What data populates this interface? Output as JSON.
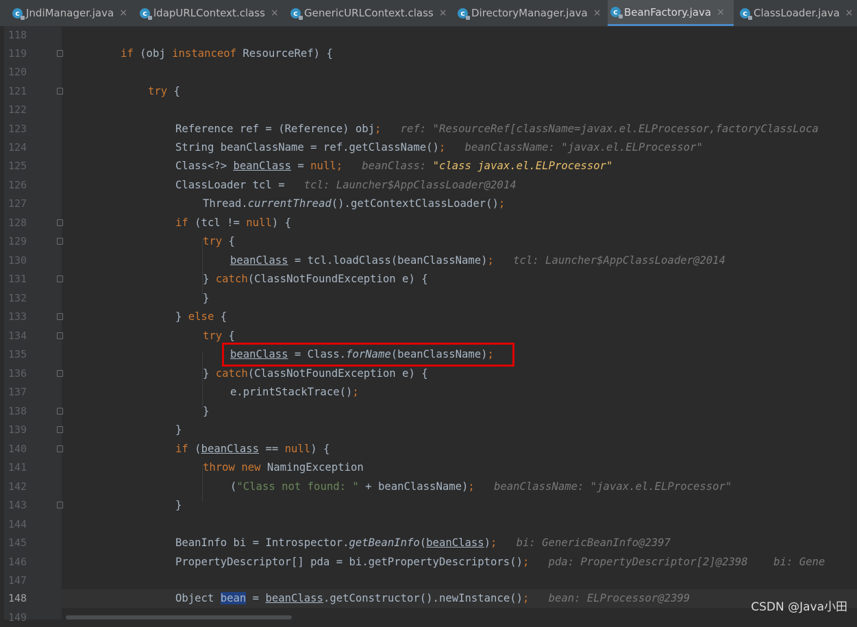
{
  "tabs": [
    {
      "label": "JndiManager.java",
      "close": "×"
    },
    {
      "label": "ldapURLContext.class",
      "close": "×"
    },
    {
      "label": "GenericURLContext.class",
      "close": "×"
    },
    {
      "label": "DirectoryManager.java",
      "close": "×"
    },
    {
      "label": "BeanFactory.java",
      "close": "×"
    },
    {
      "label": "ClassLoader.java",
      "close": "×"
    }
  ],
  "tab_icon_letter": "c",
  "line_numbers": [
    "118",
    "119",
    "120",
    "121",
    "122",
    "123",
    "124",
    "125",
    "126",
    "127",
    "128",
    "129",
    "130",
    "131",
    "132",
    "133",
    "134",
    "135",
    "136",
    "137",
    "138",
    "139",
    "140",
    "141",
    "142",
    "143",
    "144",
    "145",
    "146",
    "147",
    "148",
    "149"
  ],
  "code": {
    "l119": {
      "kw": "if",
      "a": " (obj ",
      "kw2": "instanceof",
      "b": " ResourceRef) {"
    },
    "l121": {
      "kw": "try",
      "a": " {"
    },
    "l123": {
      "a": "Reference ref = (Reference) obj",
      "semi": ";",
      "hint": "ref: \"ResourceRef[className=javax.el.ELProcessor,factoryClassLoca"
    },
    "l124": {
      "a": "String beanClassName = ref.getClassName()",
      "semi": ";",
      "hint": "beanClassName: \"javax.el.ELProcessor\""
    },
    "l125": {
      "a": "Class<?> ",
      "var": "beanClass",
      "b": " = ",
      "kw": "null",
      "semi": ";",
      "hint": "beanClass: ",
      "hintval": "\"class javax.el.ELProcessor\""
    },
    "l126": {
      "a": "ClassLoader tcl =",
      "hint": "tcl: Launcher$AppClassLoader@2014"
    },
    "l127": {
      "a": "Thread.",
      "it": "currentThread",
      "b": "().getContextClassLoader()",
      "semi": ";"
    },
    "l128": {
      "kw": "if",
      "a": " (tcl != ",
      "kw2": "null",
      "b": ") {"
    },
    "l129": {
      "kw": "try",
      "a": " {"
    },
    "l130": {
      "var": "beanClass",
      "a": " = tcl.loadClass(beanClassName)",
      "semi": ";",
      "hint": "tcl: Launcher$AppClassLoader@2014"
    },
    "l131": {
      "a": "} ",
      "kw": "catch",
      "b": "(ClassNotFoundException e) {"
    },
    "l132": {
      "a": "}"
    },
    "l133": {
      "a": "} ",
      "kw": "else",
      "b": " {"
    },
    "l134": {
      "kw": "try",
      "a": " {"
    },
    "l135": {
      "var": "beanClass",
      "a": " = Class.",
      "it": "forName",
      "b": "(beanClassName)",
      "semi": ";"
    },
    "l136": {
      "a": "} ",
      "kw": "catch",
      "b": "(ClassNotFoundException e) {"
    },
    "l137": {
      "a": "e.printStackTrace()",
      "semi": ";"
    },
    "l138": {
      "a": "}"
    },
    "l139": {
      "a": "}"
    },
    "l140": {
      "kw": "if",
      "a": " (",
      "var": "beanClass",
      "b": " == ",
      "kw2": "null",
      "c": ") {"
    },
    "l141": {
      "kw": "throw",
      "kw2": "new",
      "a": " NamingException"
    },
    "l142": {
      "a": "(",
      "str": "\"Class not found: \"",
      "b": " + beanClassName)",
      "semi": ";",
      "hint": "beanClassName: \"javax.el.ELProcessor\""
    },
    "l143": {
      "a": "}"
    },
    "l145": {
      "a": "BeanInfo bi = Introspector.",
      "it": "getBeanInfo",
      "b": "(",
      "var": "beanClass",
      "c": ")",
      "semi": ";",
      "hint": "bi: GenericBeanInfo@2397"
    },
    "l146": {
      "a": "PropertyDescriptor[] pda = bi.getPropertyDescriptors()",
      "semi": ";",
      "hint": "pda: PropertyDescriptor[2]@2398",
      "hint2": "bi: Gene"
    },
    "l148": {
      "a": "Object ",
      "sel": "bean",
      "b": " = ",
      "var": "beanClass",
      "c": ".getConstructor().newInstance()",
      "semi": ";",
      "hint": "bean: ELProcessor@2399"
    }
  },
  "watermark": "CSDN @Java小田"
}
